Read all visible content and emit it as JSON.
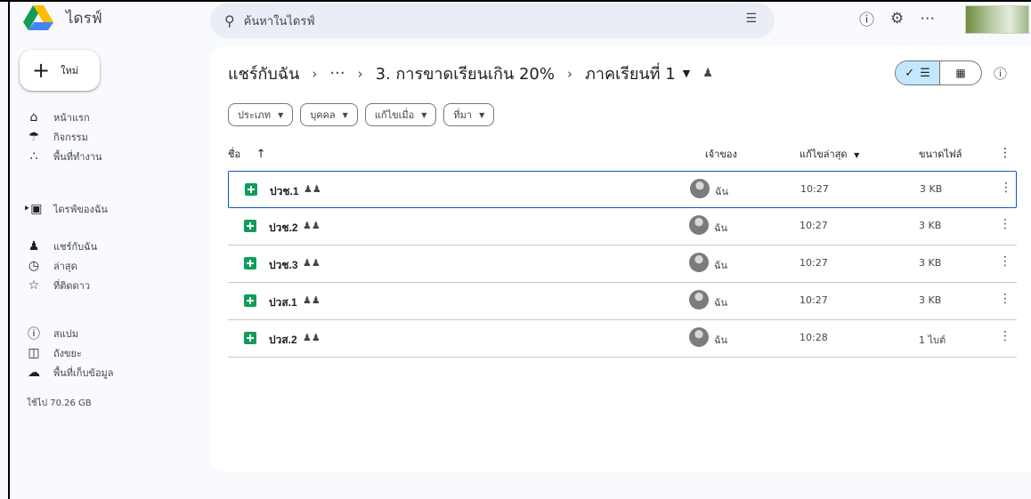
{
  "app": {
    "title": "ไดรฟ์"
  },
  "search": {
    "placeholder": "ค้นหาในไดรฟ์"
  },
  "sidebar": {
    "new_label": "ใหม่",
    "items": [
      {
        "label": "หน้าแรก",
        "icon": "home-icon"
      },
      {
        "label": "กิจกรรม",
        "icon": "bell-icon"
      },
      {
        "label": "พื้นที่ทำงาน",
        "icon": "workspaces-icon"
      },
      {
        "label": "ไดรฟ์ของฉัน",
        "icon": "my-drive-icon"
      },
      {
        "label": "แชร์กับฉัน",
        "icon": "shared-icon"
      },
      {
        "label": "ล่าสุด",
        "icon": "clock-icon"
      },
      {
        "label": "ที่ติดดาว",
        "icon": "star-icon"
      },
      {
        "label": "สแปม",
        "icon": "spam-icon"
      },
      {
        "label": "ถังขยะ",
        "icon": "trash-icon"
      },
      {
        "label": "พื้นที่เก็บข้อมูล",
        "icon": "cloud-icon"
      }
    ],
    "storage_used": "ใช้ไป 70.26 GB"
  },
  "breadcrumb": {
    "root": "แชร์กับฉัน",
    "ellipsis": "···",
    "parent": "3. การขาดเรียนเกิน 20%",
    "current": "ภาคเรียนที่ 1"
  },
  "filters": [
    "ประเภท",
    "บุคคล",
    "แก้ไขเมื่อ",
    "ที่มา"
  ],
  "table": {
    "headers": {
      "name": "ชื่อ",
      "owner": "เจ้าของ",
      "modified": "แก้ไขล่าสุด",
      "size": "ขนาดไฟล์"
    },
    "rows": [
      {
        "name": "ปวช.1",
        "owner": "ฉัน",
        "modified": "10:27",
        "size": "3 KB"
      },
      {
        "name": "ปวช.2",
        "owner": "ฉัน",
        "modified": "10:27",
        "size": "3 KB"
      },
      {
        "name": "ปวช.3",
        "owner": "ฉัน",
        "modified": "10:27",
        "size": "3 KB"
      },
      {
        "name": "ปวส.1",
        "owner": "ฉัน",
        "modified": "10:27",
        "size": "3 KB"
      },
      {
        "name": "ปวส.2",
        "owner": "ฉัน",
        "modified": "10:28",
        "size": "1 ไบต์"
      }
    ]
  },
  "colors": {
    "accent": "#0b57d0",
    "sheets_green": "#0f9d58",
    "toggle_bg": "#c2e7ff"
  }
}
